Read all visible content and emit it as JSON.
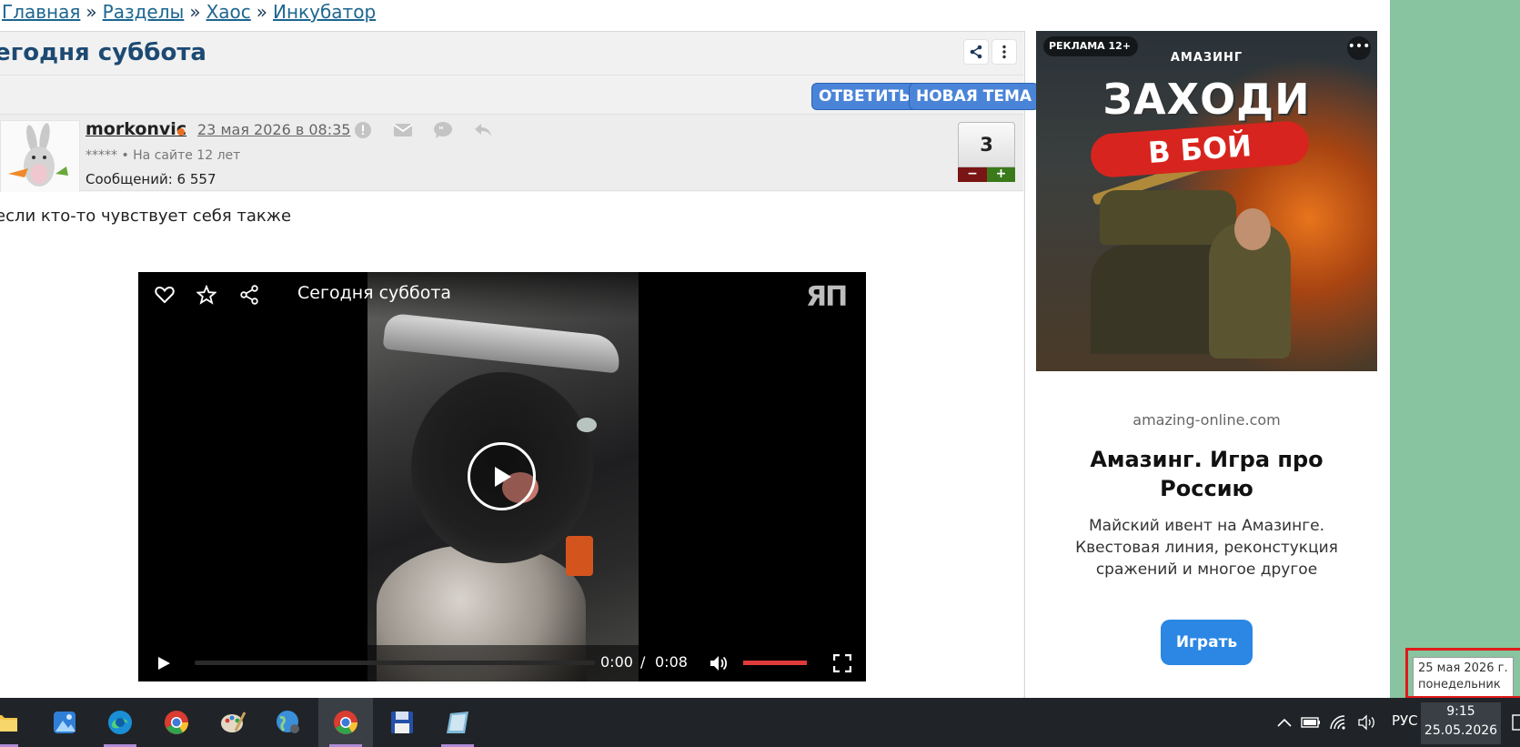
{
  "breadcrumb": {
    "items": [
      "Главная",
      "Разделы",
      "Хаос",
      "Инкубатор"
    ],
    "separator": "»"
  },
  "topic": {
    "title": "егодня суббота",
    "reply_label": "ОТВЕТИТЬ",
    "new_topic_label": "НОВАЯ ТЕМА"
  },
  "post": {
    "author": "morkonvic",
    "date": "23 мая 2026 в 08:35",
    "rank": "*****  •  На сайте 12 лет",
    "messages": "Сообщений: 6 557",
    "vote_count": "3",
    "vote_minus": "−",
    "vote_plus": "+",
    "text": "если кто-то чувствует себя также"
  },
  "video": {
    "title": "Сегодня суббота",
    "logo": "ЯП",
    "time_current": "0:00",
    "time_sep": "/",
    "time_total": "0:08"
  },
  "ad": {
    "badge": "РЕКЛАМА 12+",
    "menu": "•••",
    "brand": "АМАЗИНГ",
    "headline1": "ЗАХОДИ",
    "headline2": "В БОЙ",
    "domain": "amazing-online.com",
    "title": "Амазинг. Игра про Россию",
    "description": "Майский ивент на Амазинге. Квестовая линия, реконстукция сражений и многое другое",
    "cta": "Играть"
  },
  "tooltip": {
    "line1": "25 мая 2026 г.",
    "line2": "понедельник"
  },
  "taskbar": {
    "lang": "РУС",
    "time": "9:15",
    "date": "25.05.2026"
  },
  "colors": {
    "link": "#1d6690",
    "title": "#1d4a72",
    "pill_blue": "#4a84d8",
    "ad_cta": "#2b87e3",
    "annotation_red": "#e01a1a",
    "side_green": "#88c4a0"
  }
}
